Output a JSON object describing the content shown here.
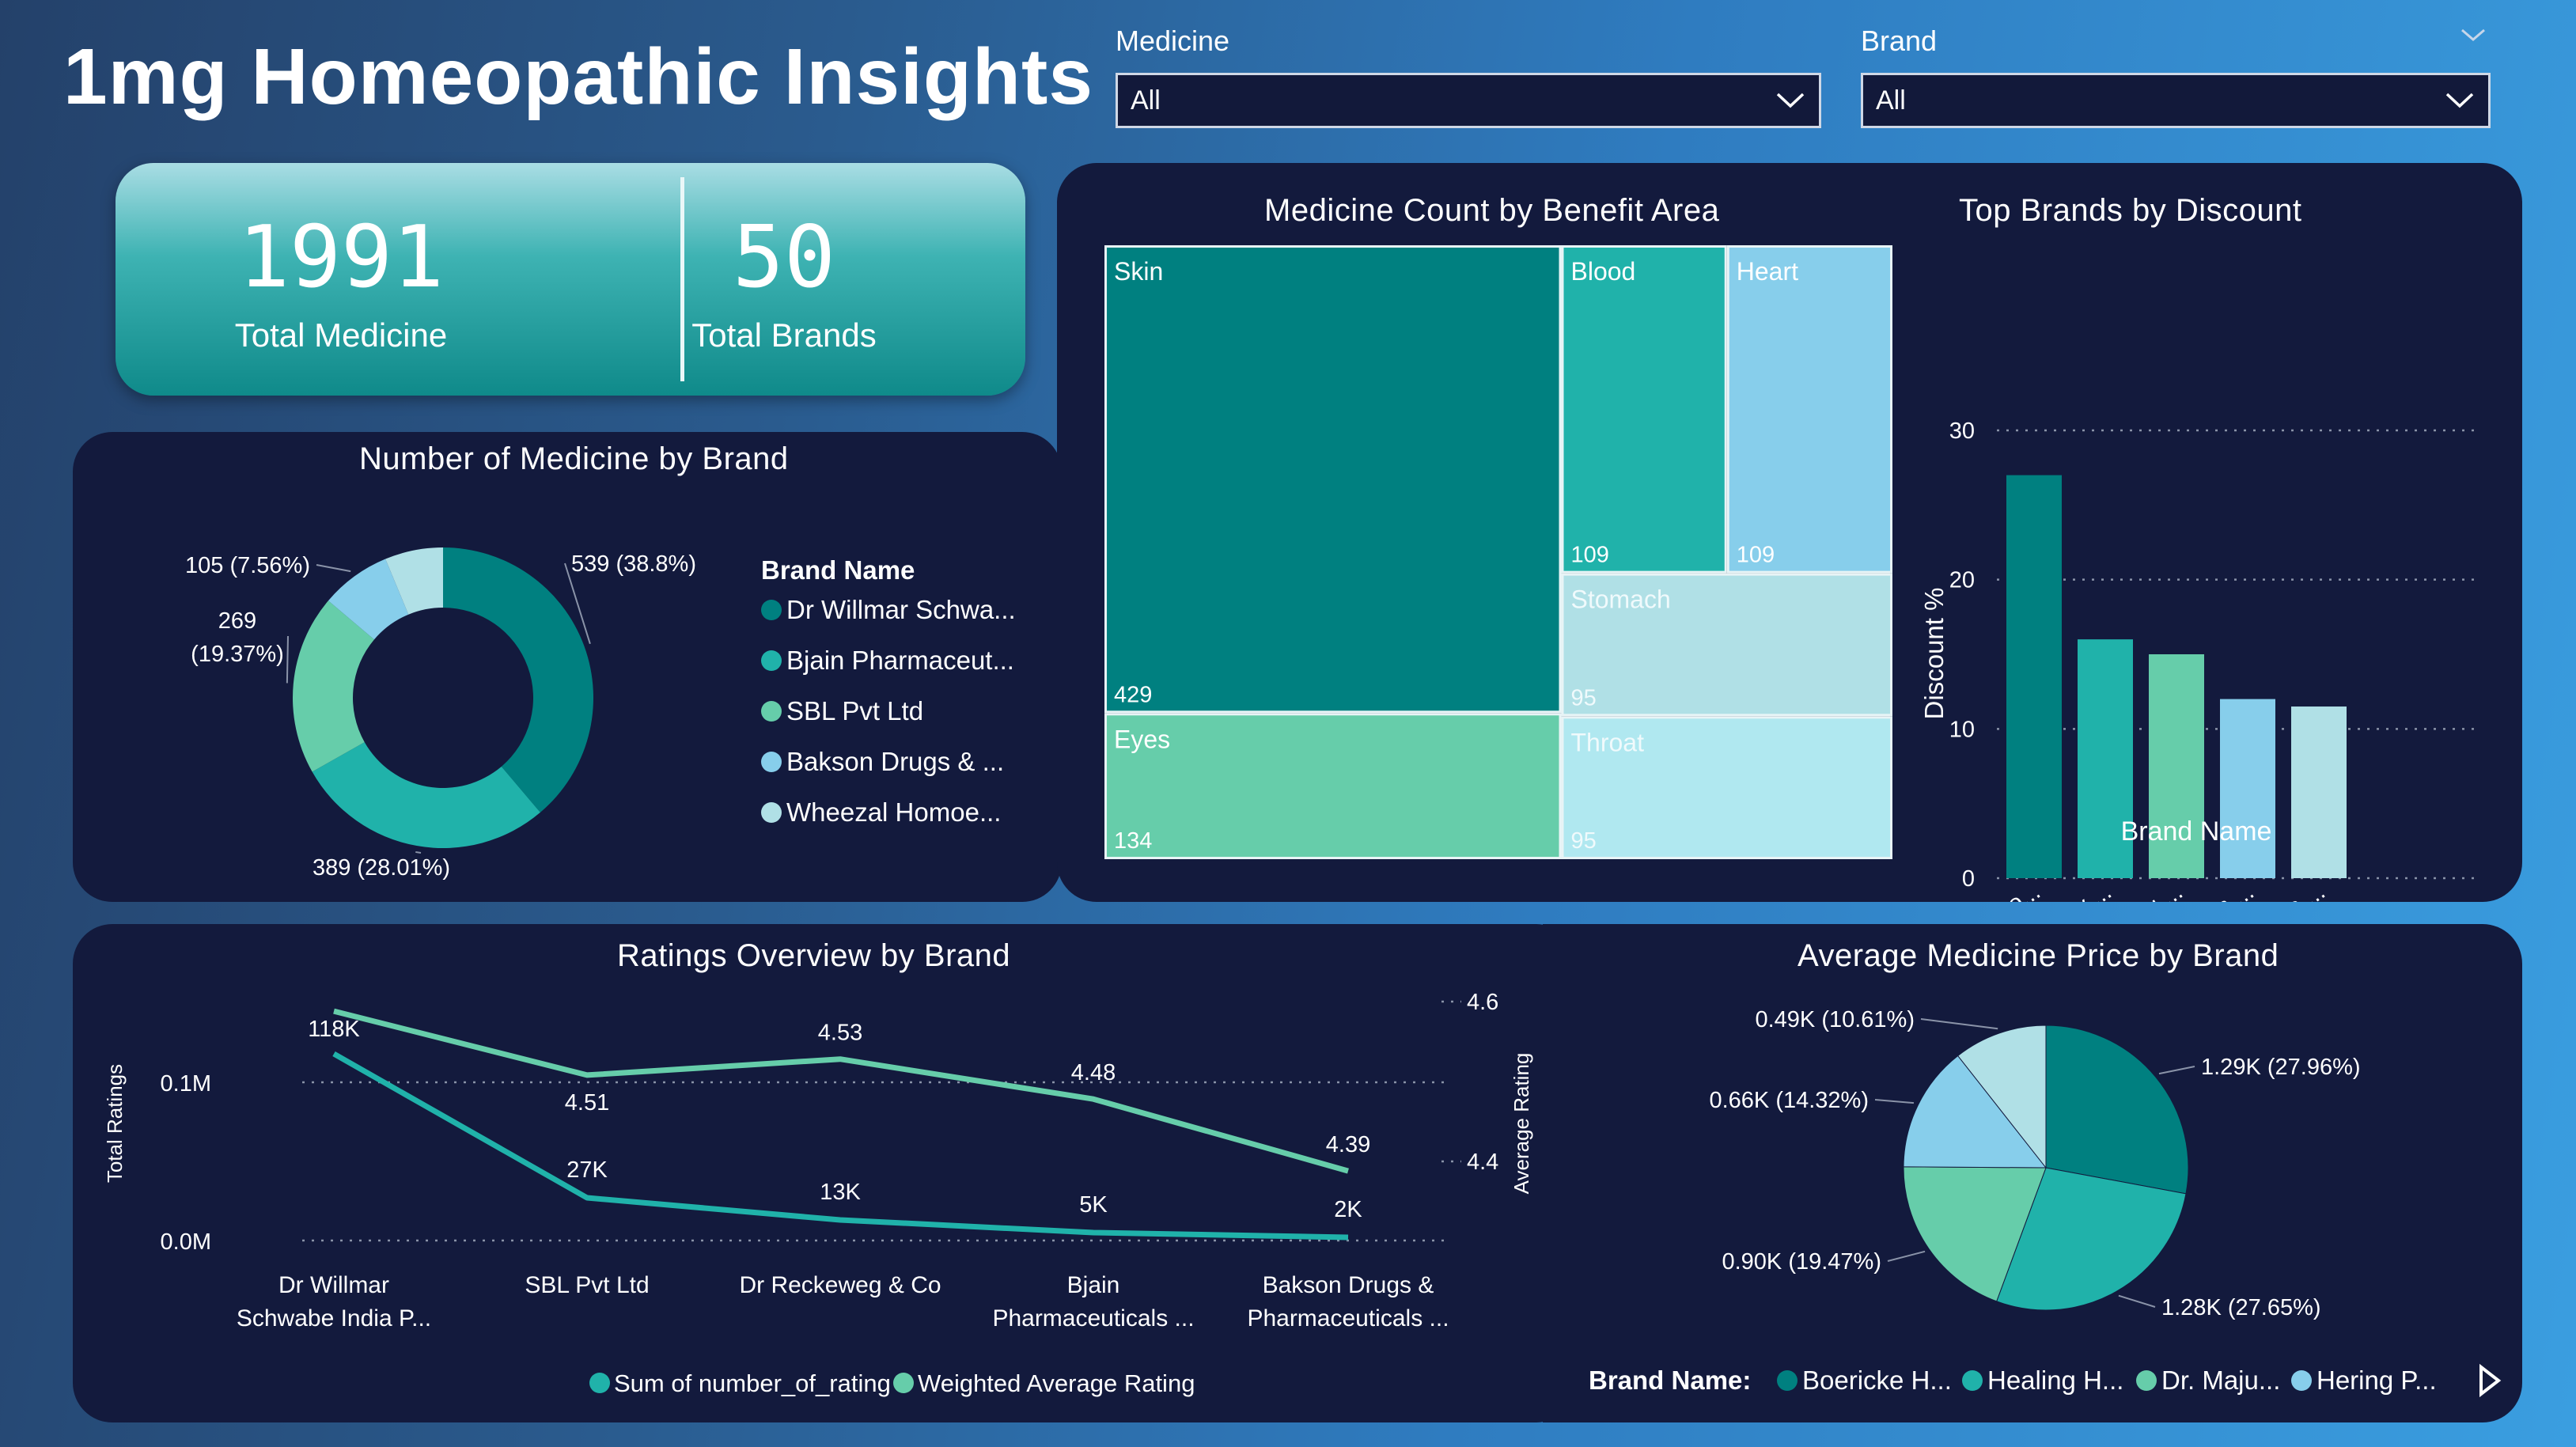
{
  "title": "1mg Homeopathic Insights",
  "slicers": {
    "medicine": {
      "label": "Medicine",
      "value": "All"
    },
    "brand": {
      "label": "Brand",
      "value": "All"
    }
  },
  "kpis": {
    "total_medicine": {
      "value": "1991",
      "label": "Total Medicine"
    },
    "total_brands": {
      "value": "50",
      "label": "Total Brands"
    }
  },
  "colors": {
    "c1": "#008080",
    "c2": "#20b2aa",
    "c3": "#66cdaa",
    "c4": "#87ceeb",
    "c5": "#b0e0e6",
    "c6": "#b0e8f0"
  },
  "chart_data": [
    {
      "type": "donut",
      "title": "Number of Medicine by Brand",
      "legend_title": "Brand Name",
      "slices": [
        {
          "name": "Dr Willmar Schwa...",
          "value": 539,
          "label": "539 (38.8%)",
          "color": "#008080"
        },
        {
          "name": "Bjain Pharmaceut...",
          "value": 389,
          "label": "389 (28.01%)",
          "color": "#20b2aa"
        },
        {
          "name": "SBL Pvt Ltd",
          "value": 269,
          "label": "269 (19.37%)",
          "color": "#66cdaa"
        },
        {
          "name": "Bakson Drugs & ...",
          "value": 105,
          "label": "105 (7.56%)",
          "color": "#87ceeb"
        },
        {
          "name": "Wheezal Homoe...",
          "value": 87,
          "label": "",
          "color": "#b0e0e6"
        }
      ]
    },
    {
      "type": "treemap",
      "title": "Medicine Count by Benefit Area",
      "items": [
        {
          "name": "Skin",
          "value": 429,
          "color": "#008080"
        },
        {
          "name": "Blood",
          "value": 109,
          "color": "#20b2aa"
        },
        {
          "name": "Heart",
          "value": 109,
          "color": "#87ceeb"
        },
        {
          "name": "Stomach",
          "value": 95,
          "color": "#b0e0e6"
        },
        {
          "name": "Eyes",
          "value": 134,
          "color": "#66cdaa"
        },
        {
          "name": "Throat",
          "value": 95,
          "color": "#b0e8f0"
        }
      ]
    },
    {
      "type": "bar",
      "title": "Top Brands by Discount",
      "xlabel": "Brand Name",
      "ylabel": "Discount %",
      "ylim": [
        0,
        30
      ],
      "yticks": [
        0,
        10,
        20,
        30
      ],
      "categories": [
        "Rxhomeo...",
        "Sett Dey ...",
        "Healing ...",
        "German ...",
        "Bio-India ..."
      ],
      "values": [
        27,
        16,
        15,
        12,
        11.5
      ],
      "colors": [
        "#008080",
        "#20b2aa",
        "#66cdaa",
        "#87ceeb",
        "#b0e0e6"
      ]
    },
    {
      "type": "line",
      "title": "Ratings Overview by Brand",
      "ylabel": "Total Ratings",
      "y2label": "Average Rating",
      "yticks": [
        "0.0M",
        "0.1M"
      ],
      "ylim": [
        0,
        0.1
      ],
      "y2ticks": [
        "4.4",
        "4.6"
      ],
      "y2lim": [
        4.4,
        4.6
      ],
      "categories": [
        "Dr Willmar|Schwabe India P...",
        "SBL Pvt Ltd",
        "Dr Reckeweg & Co",
        "Bjain|Pharmaceuticals ...",
        "Bakson Drugs &|Pharmaceuticals ..."
      ],
      "series": [
        {
          "name": "Sum of number_of_rating",
          "axis": "left",
          "values": [
            118000,
            27000,
            13000,
            5000,
            2000
          ],
          "labels": [
            "118K",
            "27K",
            "13K",
            "5K",
            "2K"
          ],
          "color": "#20b2aa"
        },
        {
          "name": "Weighted Average Rating",
          "axis": "right",
          "values": [
            4.59,
            4.51,
            4.53,
            4.48,
            4.39
          ],
          "labels": [
            "",
            "4.51",
            "4.53",
            "4.48",
            "4.39"
          ],
          "color": "#66cdaa"
        }
      ]
    },
    {
      "type": "pie",
      "title": "Average Medicine Price by Brand",
      "legend_title": "Brand Name:",
      "legend": [
        "Boericke H...",
        "Healing H...",
        "Dr. Maju...",
        "Hering P..."
      ],
      "slices": [
        {
          "value": 1290,
          "label": "1.29K (27.96%)",
          "color": "#008080"
        },
        {
          "value": 1280,
          "label": "1.28K (27.65%)",
          "color": "#20b2aa"
        },
        {
          "value": 900,
          "label": "0.90K (19.47%)",
          "color": "#66cdaa"
        },
        {
          "value": 660,
          "label": "0.66K (14.32%)",
          "color": "#87ceeb"
        },
        {
          "value": 490,
          "label": "0.49K (10.61%)",
          "color": "#b0e0e6"
        }
      ]
    }
  ]
}
